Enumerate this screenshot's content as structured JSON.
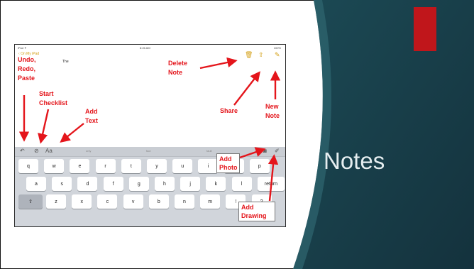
{
  "slide": {
    "title": "Notes",
    "accent_color": "#c0161b",
    "panel_color": "#1e4d58"
  },
  "screenshot": {
    "status_left": "iPad ✦",
    "status_time": "8:26 AM",
    "status_right": "100%",
    "back_label": "On My iPad",
    "doc_text": "The",
    "top_icons": [
      "trash-icon",
      "share-icon",
      "compose-icon"
    ],
    "toolbar_icons": [
      "undo-icon",
      "checklist-icon",
      "text-format-icon",
      "camera-icon",
      "drawing-icon"
    ],
    "suggestions": [
      "only",
      "fact",
      "fault"
    ],
    "keys_row1": [
      "q",
      "w",
      "e",
      "r",
      "t",
      "y",
      "u",
      "i",
      "o",
      "p"
    ],
    "keys_row2": [
      "a",
      "s",
      "d",
      "f",
      "g",
      "h",
      "j",
      "k",
      "l",
      "return"
    ],
    "keys_row3": [
      "⇧",
      "z",
      "x",
      "c",
      "v",
      "b",
      "n",
      "m",
      "!",
      "?"
    ]
  },
  "annotations": {
    "undo": "Undo, Redo, Paste",
    "checklist": "Start Checklist",
    "add_text": "Add Text",
    "delete_note": "Delete Note",
    "share": "Share",
    "new_note": "New Note",
    "add_photo": "Add Photo",
    "add_drawing": "Add Drawing"
  }
}
